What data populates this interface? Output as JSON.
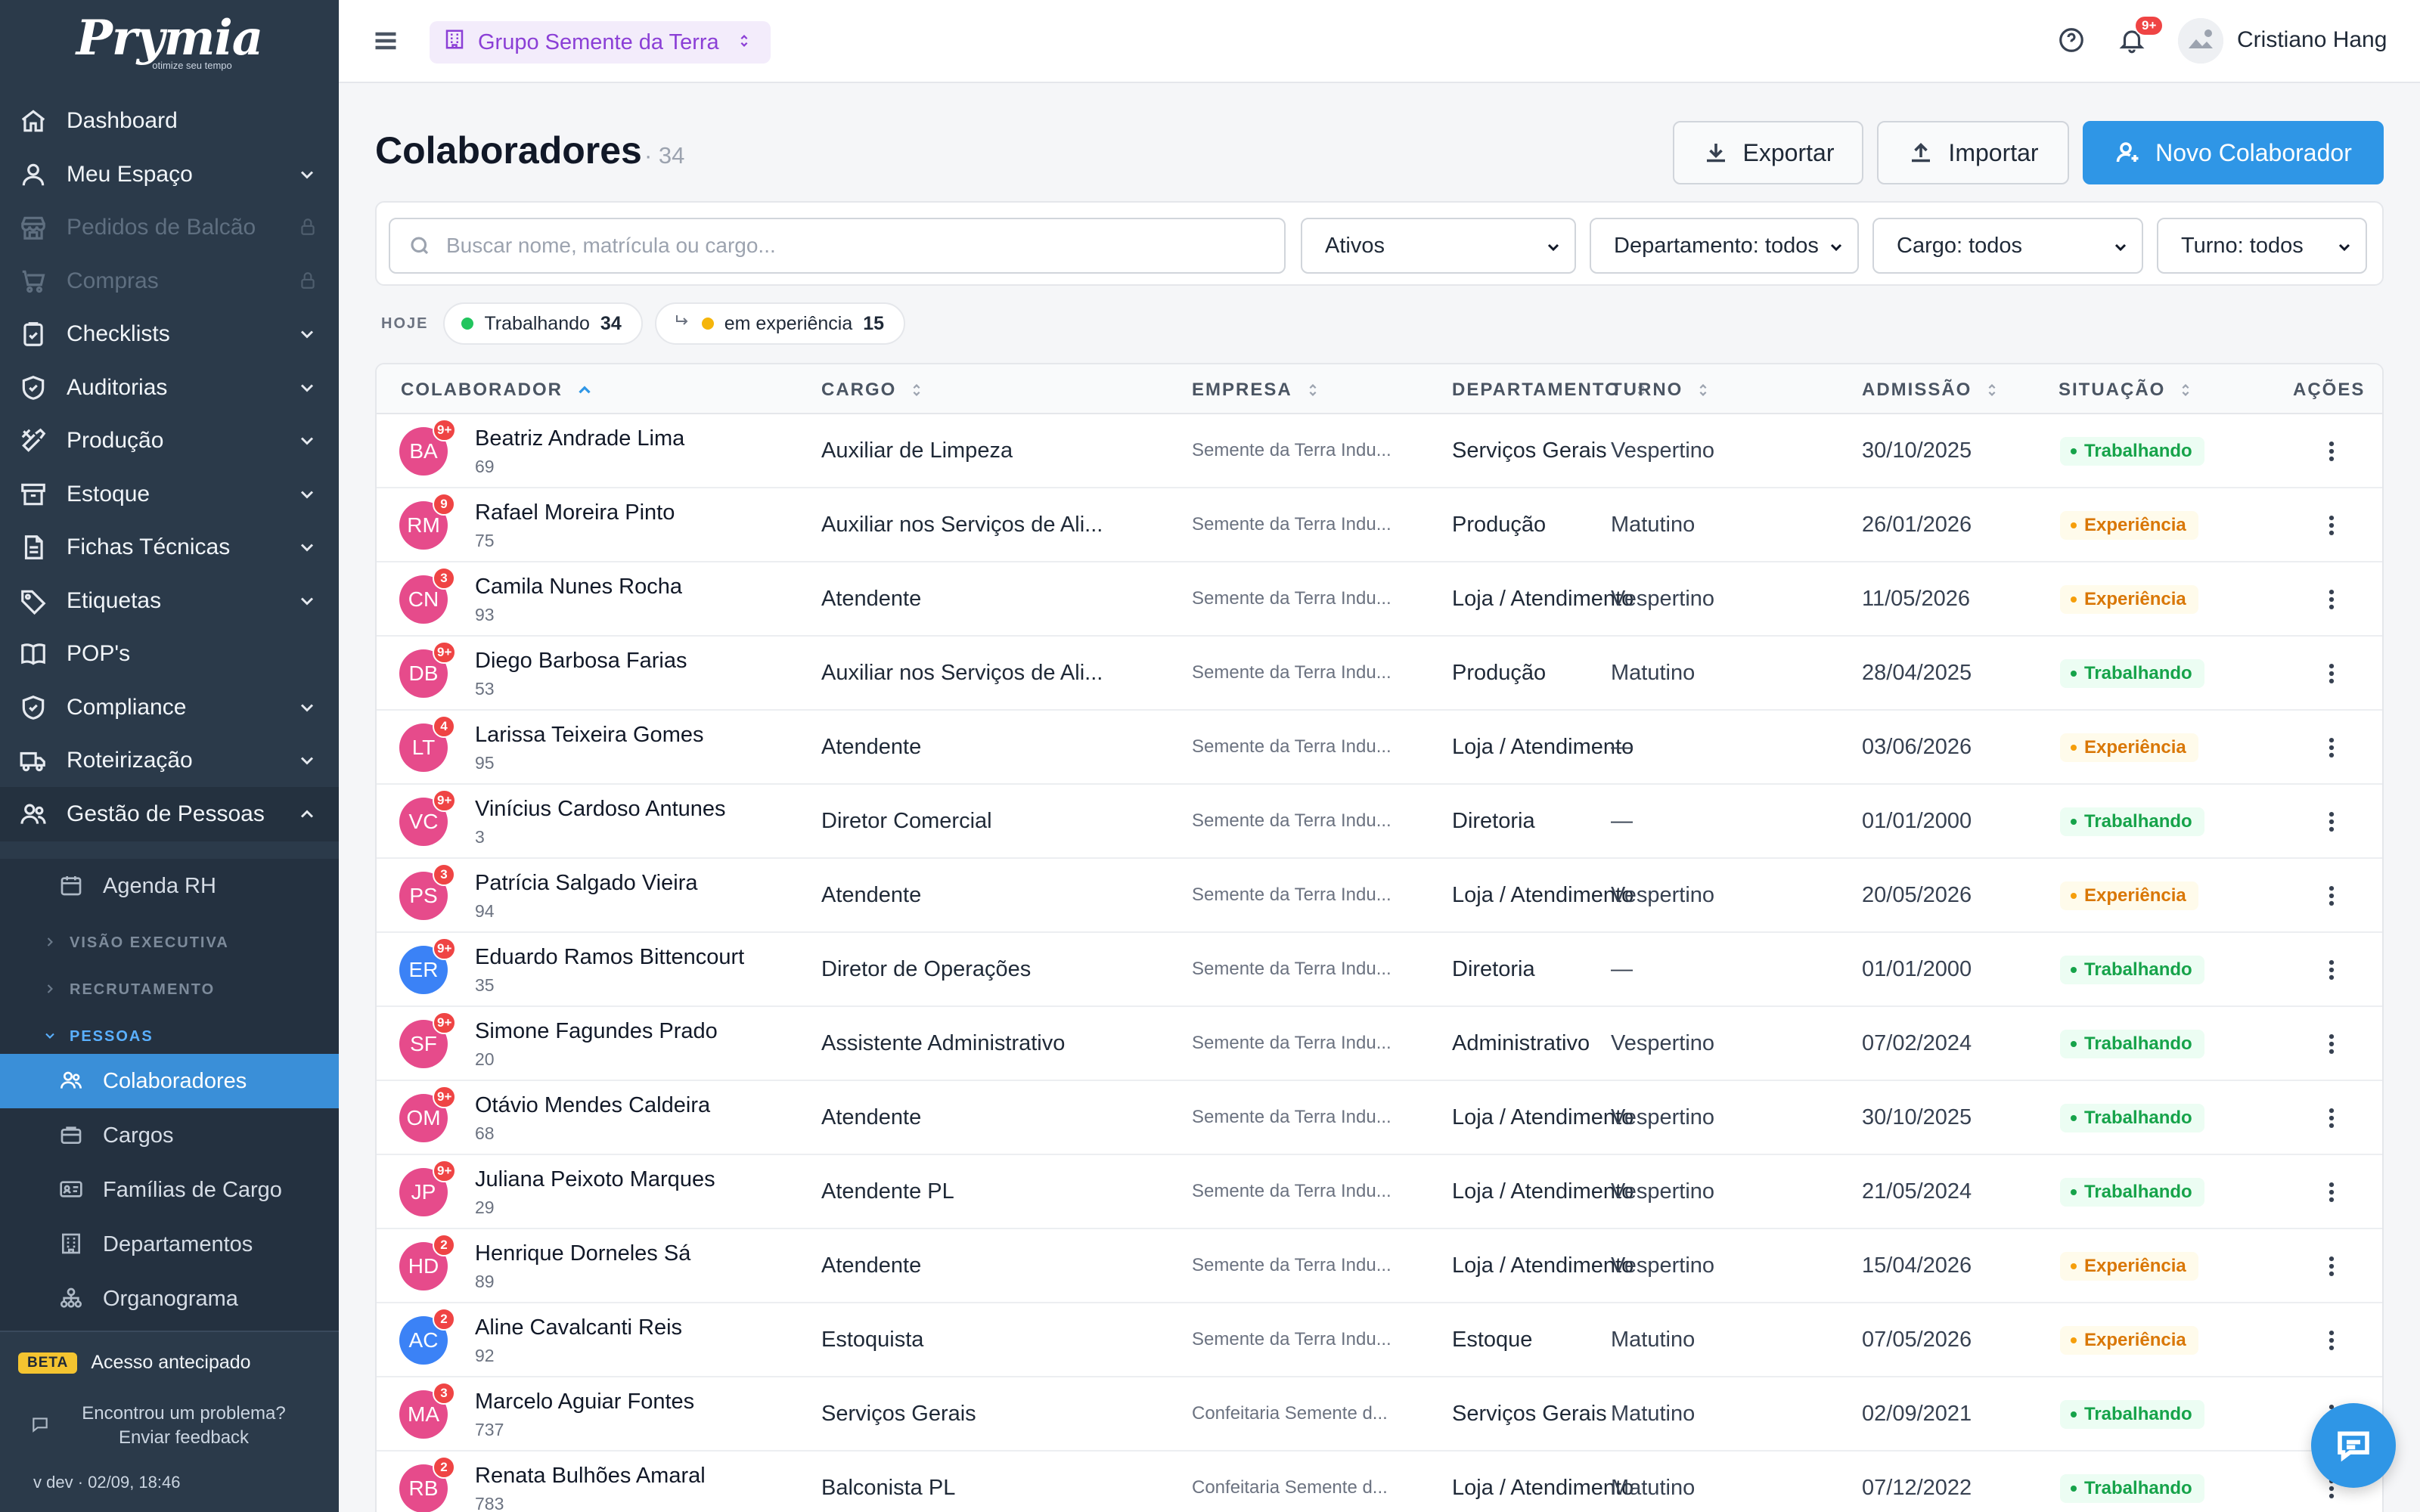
{
  "brand": {
    "name": "Prymia",
    "tagline": "otimize seu tempo"
  },
  "sidebar": {
    "items": [
      {
        "label": "Dashboard",
        "icon": "home-icon",
        "state": "normal"
      },
      {
        "label": "Meu Espaço",
        "icon": "user-icon",
        "state": "collapsible"
      },
      {
        "label": "Pedidos de Balcão",
        "icon": "store-icon",
        "state": "locked"
      },
      {
        "label": "Compras",
        "icon": "cart-icon",
        "state": "locked"
      },
      {
        "label": "Checklists",
        "icon": "clipboard-check-icon",
        "state": "collapsible"
      },
      {
        "label": "Auditorias",
        "icon": "shield-check-icon",
        "state": "collapsible"
      },
      {
        "label": "Produção",
        "icon": "tools-icon",
        "state": "collapsible"
      },
      {
        "label": "Estoque",
        "icon": "archive-icon",
        "state": "collapsible"
      },
      {
        "label": "Fichas Técnicas",
        "icon": "file-text-icon",
        "state": "collapsible"
      },
      {
        "label": "Etiquetas",
        "icon": "tag-icon",
        "state": "collapsible"
      },
      {
        "label": "POP's",
        "icon": "book-open-icon",
        "state": "normal"
      },
      {
        "label": "Compliance",
        "icon": "shield-check-icon",
        "state": "collapsible"
      },
      {
        "label": "Roteirização",
        "icon": "truck-icon",
        "state": "collapsible"
      },
      {
        "label": "Gestão de Pessoas",
        "icon": "users-icon",
        "state": "expanded"
      }
    ],
    "sub": {
      "agenda": "Agenda RH",
      "sections": [
        "VISÃO EXECUTIVA",
        "RECRUTAMENTO",
        "PESSOAS"
      ],
      "pessoas_items": [
        "Colaboradores",
        "Cargos",
        "Famílias de Cargo",
        "Departamentos",
        "Organograma"
      ],
      "active": "Colaboradores"
    },
    "footer": {
      "beta_badge": "BETA",
      "beta_text": "Acesso antecipado",
      "feedback_line1": "Encontrou um problema?",
      "feedback_line2": "Enviar feedback",
      "version": "v dev · 02/09, 18:46"
    }
  },
  "topbar": {
    "org": "Grupo Semente da Terra",
    "notifications_badge": "9+",
    "user_name": "Cristiano Hang"
  },
  "page": {
    "title": "Colaboradores",
    "count": "· 34",
    "buttons": {
      "export": "Exportar",
      "import": "Importar",
      "new": "Novo Colaborador"
    }
  },
  "filters": {
    "search_placeholder": "Buscar nome, matrícula ou cargo...",
    "status": "Ativos",
    "departamento": "Departamento: todos",
    "cargo": "Cargo: todos",
    "turno": "Turno: todos"
  },
  "today": {
    "label": "HOJE",
    "working_label": "Trabalhando",
    "working_count": "34",
    "experience_label": "em experiência",
    "experience_count": "15"
  },
  "colors": {
    "accent": "#2f96e6",
    "sidebar_bg": "#2b3a4a",
    "sidebar_active": "#3a8fd8",
    "status_ok": "#16a34a",
    "status_exp": "#d97706",
    "org_purple": "#8b3fd6"
  },
  "table": {
    "headers": [
      "COLABORADOR",
      "CARGO",
      "EMPRESA",
      "DEPARTAMENTO",
      "TURNO",
      "ADMISSÃO",
      "SITUAÇÃO",
      "AÇÕES"
    ],
    "rows": [
      {
        "initials": "BA",
        "badge": "9+",
        "name": "Beatriz Andrade Lima",
        "mat": "69",
        "cargo": "Auxiliar de Limpeza",
        "empresa": "Semente da Terra Indu...",
        "dept": "Serviços Gerais",
        "turno": "Vespertino",
        "adm": "30/10/2025",
        "status": "Trabalhando",
        "kind": "ok",
        "color": "pink"
      },
      {
        "initials": "RM",
        "badge": "9",
        "name": "Rafael Moreira Pinto",
        "mat": "75",
        "cargo": "Auxiliar nos Serviços de Ali...",
        "empresa": "Semente da Terra Indu...",
        "dept": "Produção",
        "turno": "Matutino",
        "adm": "26/01/2026",
        "status": "Experiência",
        "kind": "exp",
        "color": "pink"
      },
      {
        "initials": "CN",
        "badge": "3",
        "name": "Camila Nunes Rocha",
        "mat": "93",
        "cargo": "Atendente",
        "empresa": "Semente da Terra Indu...",
        "dept": "Loja / Atendimento",
        "turno": "Vespertino",
        "adm": "11/05/2026",
        "status": "Experiência",
        "kind": "exp",
        "color": "pink"
      },
      {
        "initials": "DB",
        "badge": "9+",
        "name": "Diego Barbosa Farias",
        "mat": "53",
        "cargo": "Auxiliar nos Serviços de Ali...",
        "empresa": "Semente da Terra Indu...",
        "dept": "Produção",
        "turno": "Matutino",
        "adm": "28/04/2025",
        "status": "Trabalhando",
        "kind": "ok",
        "color": "pink"
      },
      {
        "initials": "LT",
        "badge": "4",
        "name": "Larissa Teixeira Gomes",
        "mat": "95",
        "cargo": "Atendente",
        "empresa": "Semente da Terra Indu...",
        "dept": "Loja / Atendimento",
        "turno": "—",
        "adm": "03/06/2026",
        "status": "Experiência",
        "kind": "exp",
        "color": "pink"
      },
      {
        "initials": "VC",
        "badge": "9+",
        "name": "Vinícius Cardoso Antunes",
        "mat": "3",
        "cargo": "Diretor Comercial",
        "empresa": "Semente da Terra Indu...",
        "dept": "Diretoria",
        "turno": "—",
        "adm": "01/01/2000",
        "status": "Trabalhando",
        "kind": "ok",
        "color": "pink"
      },
      {
        "initials": "PS",
        "badge": "3",
        "name": "Patrícia Salgado Vieira",
        "mat": "94",
        "cargo": "Atendente",
        "empresa": "Semente da Terra Indu...",
        "dept": "Loja / Atendimento",
        "turno": "Vespertino",
        "adm": "20/05/2026",
        "status": "Experiência",
        "kind": "exp",
        "color": "pink"
      },
      {
        "initials": "ER",
        "badge": "9+",
        "name": "Eduardo Ramos Bittencourt",
        "mat": "35",
        "cargo": "Diretor de Operações",
        "empresa": "Semente da Terra Indu...",
        "dept": "Diretoria",
        "turno": "—",
        "adm": "01/01/2000",
        "status": "Trabalhando",
        "kind": "ok",
        "color": "blue"
      },
      {
        "initials": "SF",
        "badge": "9+",
        "name": "Simone Fagundes Prado",
        "mat": "20",
        "cargo": "Assistente Administrativo",
        "empresa": "Semente da Terra Indu...",
        "dept": "Administrativo",
        "turno": "Vespertino",
        "adm": "07/02/2024",
        "status": "Trabalhando",
        "kind": "ok",
        "color": "pink"
      },
      {
        "initials": "OM",
        "badge": "9+",
        "name": "Otávio Mendes Caldeira",
        "mat": "68",
        "cargo": "Atendente",
        "empresa": "Semente da Terra Indu...",
        "dept": "Loja / Atendimento",
        "turno": "Vespertino",
        "adm": "30/10/2025",
        "status": "Trabalhando",
        "kind": "ok",
        "color": "pink"
      },
      {
        "initials": "JP",
        "badge": "9+",
        "name": "Juliana Peixoto Marques",
        "mat": "29",
        "cargo": "Atendente PL",
        "empresa": "Semente da Terra Indu...",
        "dept": "Loja / Atendimento",
        "turno": "Vespertino",
        "adm": "21/05/2024",
        "status": "Trabalhando",
        "kind": "ok",
        "color": "pink"
      },
      {
        "initials": "HD",
        "badge": "2",
        "name": "Henrique Dorneles Sá",
        "mat": "89",
        "cargo": "Atendente",
        "empresa": "Semente da Terra Indu...",
        "dept": "Loja / Atendimento",
        "turno": "Vespertino",
        "adm": "15/04/2026",
        "status": "Experiência",
        "kind": "exp",
        "color": "pink"
      },
      {
        "initials": "AC",
        "badge": "2",
        "name": "Aline Cavalcanti Reis",
        "mat": "92",
        "cargo": "Estoquista",
        "empresa": "Semente da Terra Indu...",
        "dept": "Estoque",
        "turno": "Matutino",
        "adm": "07/05/2026",
        "status": "Experiência",
        "kind": "exp",
        "color": "blue"
      },
      {
        "initials": "MA",
        "badge": "3",
        "name": "Marcelo Aguiar Fontes",
        "mat": "737",
        "cargo": "Serviços Gerais",
        "empresa": "Confeitaria Semente d...",
        "dept": "Serviços Gerais",
        "turno": "Matutino",
        "adm": "02/09/2021",
        "status": "Trabalhando",
        "kind": "ok",
        "color": "pink"
      },
      {
        "initials": "RB",
        "badge": "2",
        "name": "Renata Bulhões Amaral",
        "mat": "783",
        "cargo": "Balconista PL",
        "empresa": "Confeitaria Semente d...",
        "dept": "Loja / Atendimento",
        "turno": "Matutino",
        "adm": "07/12/2022",
        "status": "Trabalhando",
        "kind": "ok",
        "color": "pink"
      }
    ]
  }
}
